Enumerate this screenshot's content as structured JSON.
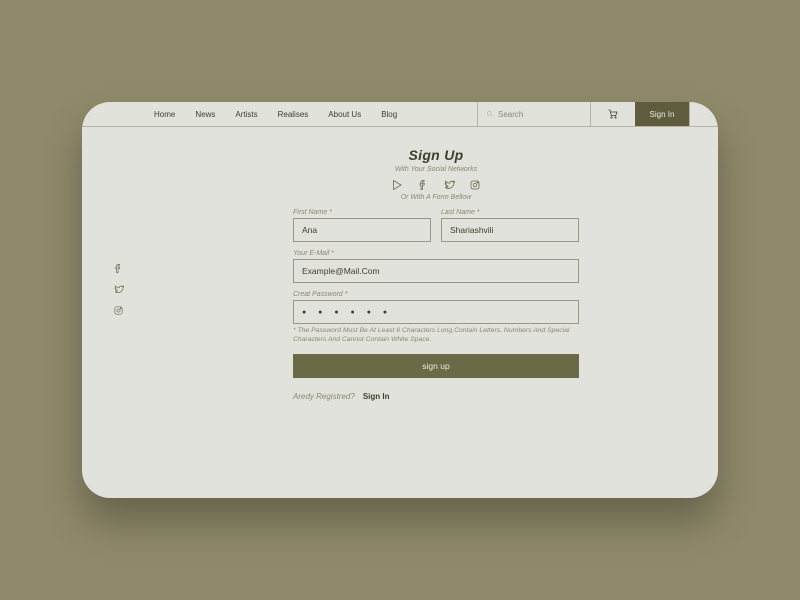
{
  "nav": {
    "links": [
      "Home",
      "News",
      "Artists",
      "Realises",
      "About Us",
      "Blog"
    ],
    "search_placeholder": "Search",
    "signin": "Sign In"
  },
  "page": {
    "title": "Sign Up",
    "social_sub": "With Your Social Networks",
    "form_sub": "Or With A Form Bellow"
  },
  "form": {
    "first_name": {
      "label": "First Name *",
      "value": "Ana"
    },
    "last_name": {
      "label": "Last Name *",
      "value": "Shariashvili"
    },
    "email": {
      "label": "Your E-Mail *",
      "value": "Example@Mail.Com"
    },
    "password": {
      "label": "Creat Password *",
      "value": "● ● ● ● ● ●"
    },
    "hint": "* The Password Must Be At Least 6 Characters Long,Contain Letters, Numbers And Special Characters And Cannot Contain White Space.",
    "submit": "sign up"
  },
  "footer": {
    "already": "Aredy Registred?",
    "signin": "Sign In"
  }
}
